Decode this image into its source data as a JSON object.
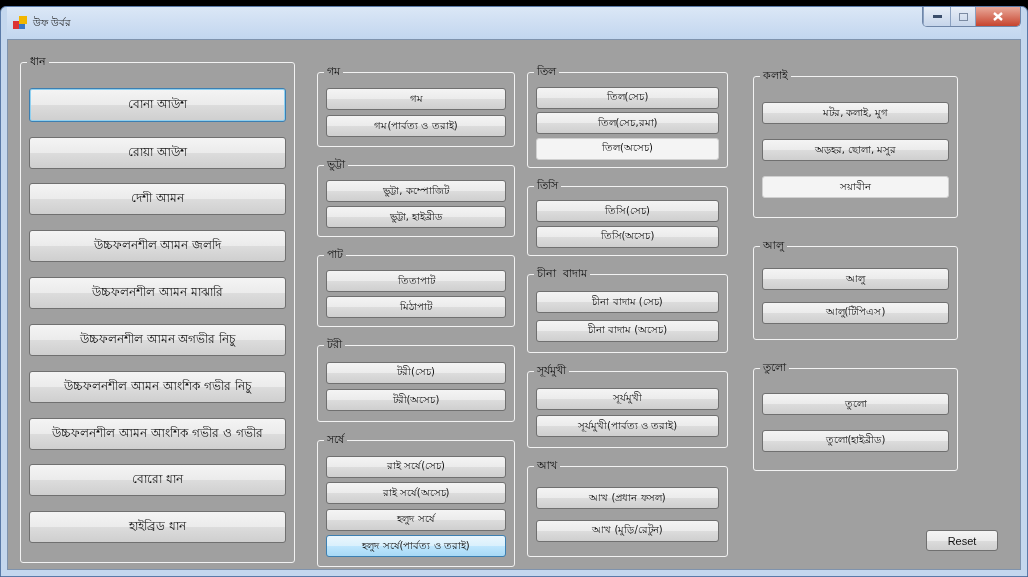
{
  "window": {
    "title": "উফ উর্বর"
  },
  "columns": [
    [
      {
        "title": "ধান",
        "buttons": [
          {
            "label": "বোনা আউশ",
            "focused": true,
            "hovered": false,
            "flat": false
          },
          {
            "label": "রোয়া আউশ",
            "focused": false,
            "hovered": false,
            "flat": false
          },
          {
            "label": "দেশী আমন",
            "focused": false,
            "hovered": false,
            "flat": false
          },
          {
            "label": "উচ্চফলনশীল আমন জলদি",
            "focused": false,
            "hovered": false,
            "flat": false
          },
          {
            "label": "উচ্চফলনশীল আমন মাঝারি",
            "focused": false,
            "hovered": false,
            "flat": false
          },
          {
            "label": "উচ্চফলনশীল আমন অগভীর নিচু",
            "focused": false,
            "hovered": false,
            "flat": false
          },
          {
            "label": "উচ্চফলনশীল আমন আংশিক গভীর নিচু",
            "focused": false,
            "hovered": false,
            "flat": false
          },
          {
            "label": "উচ্চফলনশীল আমন আংশিক গভীর ও গভীর",
            "focused": false,
            "hovered": false,
            "flat": false
          },
          {
            "label": "বোরো ধান",
            "focused": false,
            "hovered": false,
            "flat": false
          },
          {
            "label": "হাইব্রিড ধান",
            "focused": false,
            "hovered": false,
            "flat": false
          }
        ]
      }
    ],
    [
      {
        "title": "গম",
        "buttons": [
          {
            "label": "গম",
            "focused": false,
            "hovered": false,
            "flat": false
          },
          {
            "label": "গম(পার্বত্য ও তরাই)",
            "focused": false,
            "hovered": false,
            "flat": false
          }
        ]
      },
      {
        "title": "ভুট্টা",
        "buttons": [
          {
            "label": "ভুট্টা, কম্পোজিট",
            "focused": false,
            "hovered": false,
            "flat": false
          },
          {
            "label": "ভুট্টা, হাইব্রীড",
            "focused": false,
            "hovered": false,
            "flat": false
          }
        ]
      },
      {
        "title": "পাট",
        "buttons": [
          {
            "label": "তিতাপাট",
            "focused": false,
            "hovered": false,
            "flat": false
          },
          {
            "label": "মিঠাপাট",
            "focused": false,
            "hovered": false,
            "flat": false
          }
        ]
      },
      {
        "title": "টরী",
        "buttons": [
          {
            "label": "টরী(সেচ)",
            "focused": false,
            "hovered": false,
            "flat": false
          },
          {
            "label": "টরী(অসেচ)",
            "focused": false,
            "hovered": false,
            "flat": false
          }
        ]
      },
      {
        "title": "সর্ষে",
        "buttons": [
          {
            "label": "রাই সর্ষে(সেচ)",
            "focused": false,
            "hovered": false,
            "flat": false
          },
          {
            "label": "রাই সর্ষে(অসেচ)",
            "focused": false,
            "hovered": false,
            "flat": false
          },
          {
            "label": "হলুদ সর্ষে",
            "focused": false,
            "hovered": false,
            "flat": false
          },
          {
            "label": "হলুদ সর্ষে(পার্বত্য ও তরাই)",
            "focused": false,
            "hovered": true,
            "flat": false
          }
        ]
      }
    ],
    [
      {
        "title": "তিল",
        "buttons": [
          {
            "label": "তিল(সেচ)",
            "focused": false,
            "hovered": false,
            "flat": false
          },
          {
            "label": "তিল(সেচ,রমা)",
            "focused": false,
            "hovered": false,
            "flat": false
          },
          {
            "label": "তিল(অসেচ)",
            "focused": false,
            "hovered": false,
            "flat": true
          }
        ]
      },
      {
        "title": "তিসি",
        "buttons": [
          {
            "label": "তিসি(সেচ)",
            "focused": false,
            "hovered": false,
            "flat": false
          },
          {
            "label": "তিসি(অসেচ)",
            "focused": false,
            "hovered": false,
            "flat": false
          }
        ]
      },
      {
        "title": "চীনা  বাদাম",
        "buttons": [
          {
            "label": "চীনা বাদাম (সেচ)",
            "focused": false,
            "hovered": false,
            "flat": false
          },
          {
            "label": "চীনা বাদাম (অসেচ)",
            "focused": false,
            "hovered": false,
            "flat": false
          }
        ]
      },
      {
        "title": "সূর্যমুখী",
        "buttons": [
          {
            "label": "সূর্যমুখী",
            "focused": false,
            "hovered": false,
            "flat": false
          },
          {
            "label": "সূর্যমুখী(পার্বত্য ও তরাই)",
            "focused": false,
            "hovered": false,
            "flat": false
          }
        ]
      },
      {
        "title": "আখ",
        "buttons": [
          {
            "label": "আখ (প্রধান ফসল)",
            "focused": false,
            "hovered": false,
            "flat": false
          },
          {
            "label": "আখ (মুড়ি/রেটুন)",
            "focused": false,
            "hovered": false,
            "flat": false
          }
        ]
      }
    ],
    [
      {
        "title": "কলাই",
        "buttons": [
          {
            "label": "মটর, কলাই, মুগ",
            "focused": false,
            "hovered": false,
            "flat": false
          },
          {
            "label": "অড়হর, ছোলা, মসুর",
            "focused": false,
            "hovered": false,
            "flat": false
          },
          {
            "label": "সয়াবীন",
            "focused": false,
            "hovered": false,
            "flat": true
          }
        ]
      },
      {
        "title": "আলু",
        "buttons": [
          {
            "label": "আলু",
            "focused": false,
            "hovered": false,
            "flat": false
          },
          {
            "label": "আলু(টিপিএস)",
            "focused": false,
            "hovered": false,
            "flat": false
          }
        ]
      },
      {
        "title": "তুলো",
        "buttons": [
          {
            "label": "তুলো",
            "focused": false,
            "hovered": false,
            "flat": false
          },
          {
            "label": "তুলো(হাইব্রীড)",
            "focused": false,
            "hovered": false,
            "flat": false
          }
        ]
      }
    ]
  ],
  "reset_button": {
    "label": "Reset"
  }
}
